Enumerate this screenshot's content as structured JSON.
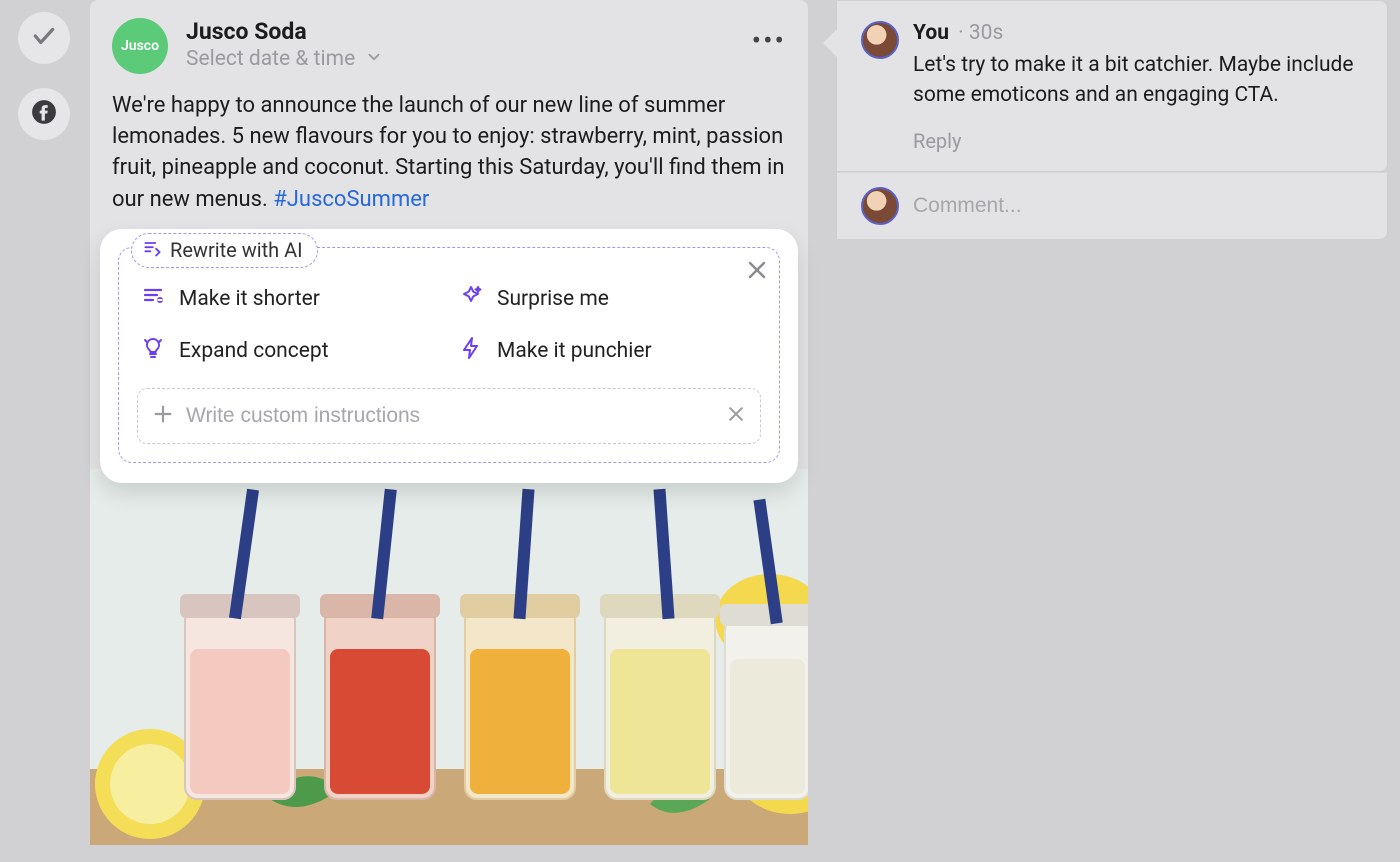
{
  "left": {
    "confirm_btn": "confirm",
    "facebook_btn": "facebook"
  },
  "post": {
    "brand": {
      "name": "Jusco Soda",
      "avatar_text": "Jusco"
    },
    "date_hint": "Select date & time",
    "body_text": "We're happy to announce the launch of our new line of summer lemonades. 5 new flavours for you to enjoy: strawberry, mint, passion fruit, pineapple and coconut. Starting this Saturday, you'll find them in our new menus. ",
    "hashtag": "#JuscoSummer"
  },
  "ai_panel": {
    "legend": "Rewrite with AI",
    "options": [
      {
        "id": "shorter",
        "label": "Make it shorter"
      },
      {
        "id": "surprise",
        "label": "Surprise me"
      },
      {
        "id": "expand",
        "label": "Expand concept"
      },
      {
        "id": "punchy",
        "label": "Make it punchier"
      }
    ],
    "custom_placeholder": "Write custom instructions"
  },
  "thread": {
    "comment": {
      "author": "You",
      "time": "30s",
      "text": "Let's try to make it a bit catchier. Maybe include some emoticons and an engaging CTA.",
      "reply_label": "Reply"
    },
    "input_placeholder": "Comment..."
  }
}
